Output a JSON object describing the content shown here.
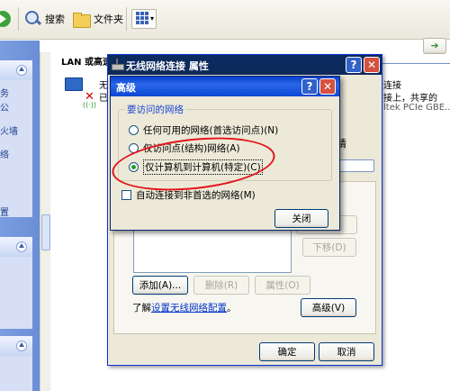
{
  "toolbar": {
    "search_label": "搜索",
    "folders_label": "文件夹"
  },
  "content": {
    "heading": "LAN 或高速",
    "right_frag_1": "连接",
    "right_frag_2": "接上，共享的",
    "right_frag_3": "ltek PCIe GBE...",
    "left_frag_1": "无",
    "left_frag_2": "已"
  },
  "taskpane": {
    "frag_a": "务",
    "frag_b": "公",
    "frag_c": "火墙",
    "frag_d": "络",
    "frag_e": "置"
  },
  "properties_dialog": {
    "title": "无线网络连接 属性",
    "right_label": "请",
    "buttons": {
      "move_down": "下移(D)",
      "add": "添加(A)...",
      "remove": "删除(R)",
      "properties": "属性(O)",
      "advanced": "高级(V)",
      "ok": "确定",
      "cancel": "取消"
    },
    "learn_prefix": "了解",
    "learn_link": "设置无线网络配置",
    "learn_suffix": "。"
  },
  "advanced_dialog": {
    "title": "高级",
    "group_label": "要访问的网络",
    "options": [
      {
        "label": "任何可用的网络(首选访问点)(N)",
        "selected": false
      },
      {
        "label": "仅访问点(结构)网络(A)",
        "selected": false
      },
      {
        "label": "仅计算机到计算机(特定)(C)",
        "selected": true
      }
    ],
    "auto_connect_label": "自动连接到非首选的网络(M)",
    "auto_connect_checked": false,
    "close_button": "关闭"
  },
  "colors": {
    "annotation": "#e3141c",
    "xp_title_active": "#2a67e8",
    "xp_title_inactive": "#0b2a5e"
  }
}
